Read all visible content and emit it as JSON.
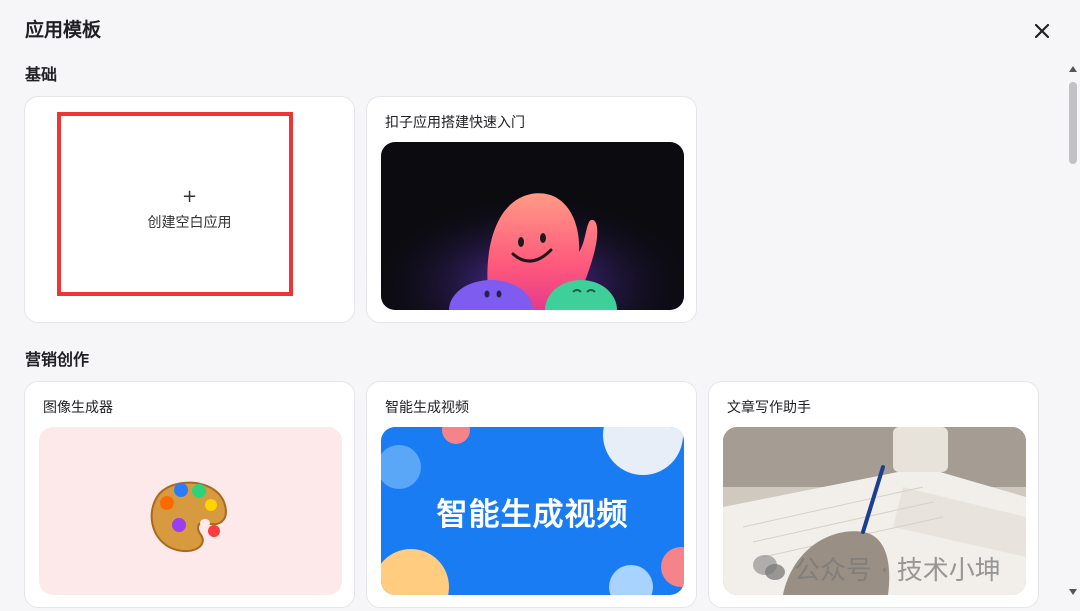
{
  "modal": {
    "title": "应用模板"
  },
  "sections": {
    "basic": {
      "title": "基础",
      "blank_card": {
        "plus": "+",
        "label": "创建空白应用"
      },
      "quickstart_card": {
        "title": "扣子应用搭建快速入门"
      }
    },
    "marketing": {
      "title": "营销创作",
      "cards": [
        {
          "title": "图像生成器"
        },
        {
          "title": "智能生成视频",
          "image_text": "智能生成视频"
        },
        {
          "title": "文章写作助手"
        }
      ]
    }
  },
  "watermark": {
    "text": "公众号 · 技术小坤"
  },
  "colors": {
    "highlight": "#ee3434",
    "video_bg": "#1a7cf2",
    "palette_bg": "#fde9e9",
    "dark_bg": "#0b0b10"
  },
  "icons": {
    "close": "close-icon",
    "scroll_up": "chevron-up-icon",
    "scroll_down": "chevron-down-icon"
  }
}
